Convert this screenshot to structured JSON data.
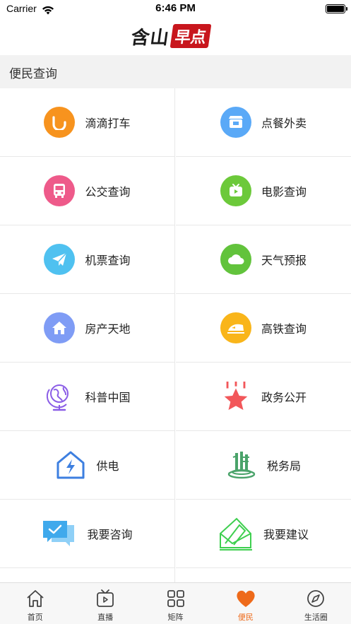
{
  "status_bar": {
    "carrier": "Carrier",
    "time": "6:46 PM"
  },
  "header": {
    "logo_dark": "含山",
    "logo_red": "早点"
  },
  "section": {
    "title": "便民查询"
  },
  "services": [
    {
      "label": "滴滴打车",
      "icon": "didi-icon",
      "color": "#f7931e"
    },
    {
      "label": "点餐外卖",
      "icon": "food-delivery-icon",
      "color": "#5aa9f7"
    },
    {
      "label": "公交查询",
      "icon": "bus-icon",
      "color": "#ee5a8a"
    },
    {
      "label": "电影查询",
      "icon": "movie-tv-icon",
      "color": "#6cc93a"
    },
    {
      "label": "机票查询",
      "icon": "paper-plane-icon",
      "color": "#4fc1f0"
    },
    {
      "label": "天气预报",
      "icon": "weather-cloud-icon",
      "color": "#62c33c"
    },
    {
      "label": "房产天地",
      "icon": "house-icon",
      "color": "#7f9cf5"
    },
    {
      "label": "高铁查询",
      "icon": "high-speed-train-icon",
      "color": "#f9b51a"
    },
    {
      "label": "科普中国",
      "icon": "globe-icon",
      "color": "#8a5ce6"
    },
    {
      "label": "政务公开",
      "icon": "star-icon",
      "color": "#f2575a"
    },
    {
      "label": "供电",
      "icon": "power-house-icon",
      "color": "#3d7fe0"
    },
    {
      "label": "税务局",
      "icon": "tax-bureau-icon",
      "color": "#4aa36a"
    },
    {
      "label": "我要咨询",
      "icon": "chat-bubble-icon",
      "color": "#3fa9ec"
    },
    {
      "label": "我要建议",
      "icon": "envelope-suggest-icon",
      "color": "#3ecf4f"
    }
  ],
  "tabs": [
    {
      "label": "首页",
      "icon": "home-icon",
      "active": false
    },
    {
      "label": "直播",
      "icon": "tv-play-icon",
      "active": false
    },
    {
      "label": "矩阵",
      "icon": "grid-icon",
      "active": false
    },
    {
      "label": "便民",
      "icon": "heart-icon",
      "active": true
    },
    {
      "label": "生活圈",
      "icon": "compass-icon",
      "active": false
    }
  ],
  "colors": {
    "accent": "#ee6a1a",
    "logo_red": "#c8161d",
    "section_bg": "#f2f2f2"
  }
}
